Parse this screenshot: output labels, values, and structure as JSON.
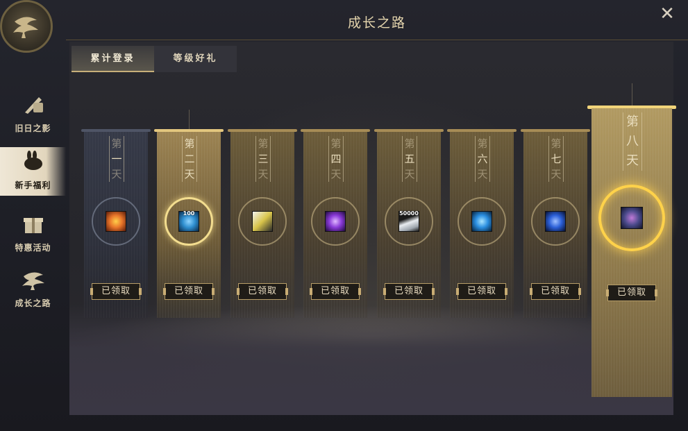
{
  "window": {
    "title": "成长之路",
    "close_icon": "close-icon"
  },
  "sidebar": {
    "items": [
      {
        "label": "旧日之影",
        "icon": "sword-scroll-icon",
        "active": false
      },
      {
        "label": "新手福利",
        "icon": "rabbit-cloud-icon",
        "active": true
      },
      {
        "label": "特惠活动",
        "icon": "gift-box-icon",
        "active": false
      },
      {
        "label": "成长之路",
        "icon": "pine-tree-icon",
        "active": false
      }
    ]
  },
  "tabs": [
    {
      "label": "累计登录",
      "active": true
    },
    {
      "label": "等级好礼",
      "active": false
    }
  ],
  "days": [
    {
      "chars": [
        "第",
        "一",
        "天"
      ],
      "claim_label": "已领取",
      "item": "fire-orb-icon",
      "item_color": "#e8752a",
      "qty": ""
    },
    {
      "chars": [
        "第",
        "二",
        "天"
      ],
      "claim_label": "已领取",
      "item": "blue-sphere-icon",
      "item_color": "#2f8fd0",
      "qty": "100"
    },
    {
      "chars": [
        "第",
        "三",
        "天"
      ],
      "claim_label": "已领取",
      "item": "tiger-mask-icon",
      "item_color": "#d8c44a",
      "qty": ""
    },
    {
      "chars": [
        "第",
        "四",
        "天"
      ],
      "claim_label": "已领取",
      "item": "purple-gem-icon",
      "item_color": "#8a3ad8",
      "qty": ""
    },
    {
      "chars": [
        "第",
        "五",
        "天"
      ],
      "claim_label": "已领取",
      "item": "silver-ingot-icon",
      "item_color": "#c9cfd6",
      "qty": "50000"
    },
    {
      "chars": [
        "第",
        "六",
        "天"
      ],
      "claim_label": "已领取",
      "item": "blue-orb-icon",
      "item_color": "#2a8ee0",
      "qty": ""
    },
    {
      "chars": [
        "第",
        "七",
        "天"
      ],
      "claim_label": "已领取",
      "item": "blue-crystal-icon",
      "item_color": "#2c60d8",
      "qty": ""
    },
    {
      "chars": [
        "第",
        "八",
        "天"
      ],
      "claim_label": "已领取",
      "item": "mount-creature-icon",
      "item_color": "#4a4a8a",
      "qty": ""
    }
  ]
}
